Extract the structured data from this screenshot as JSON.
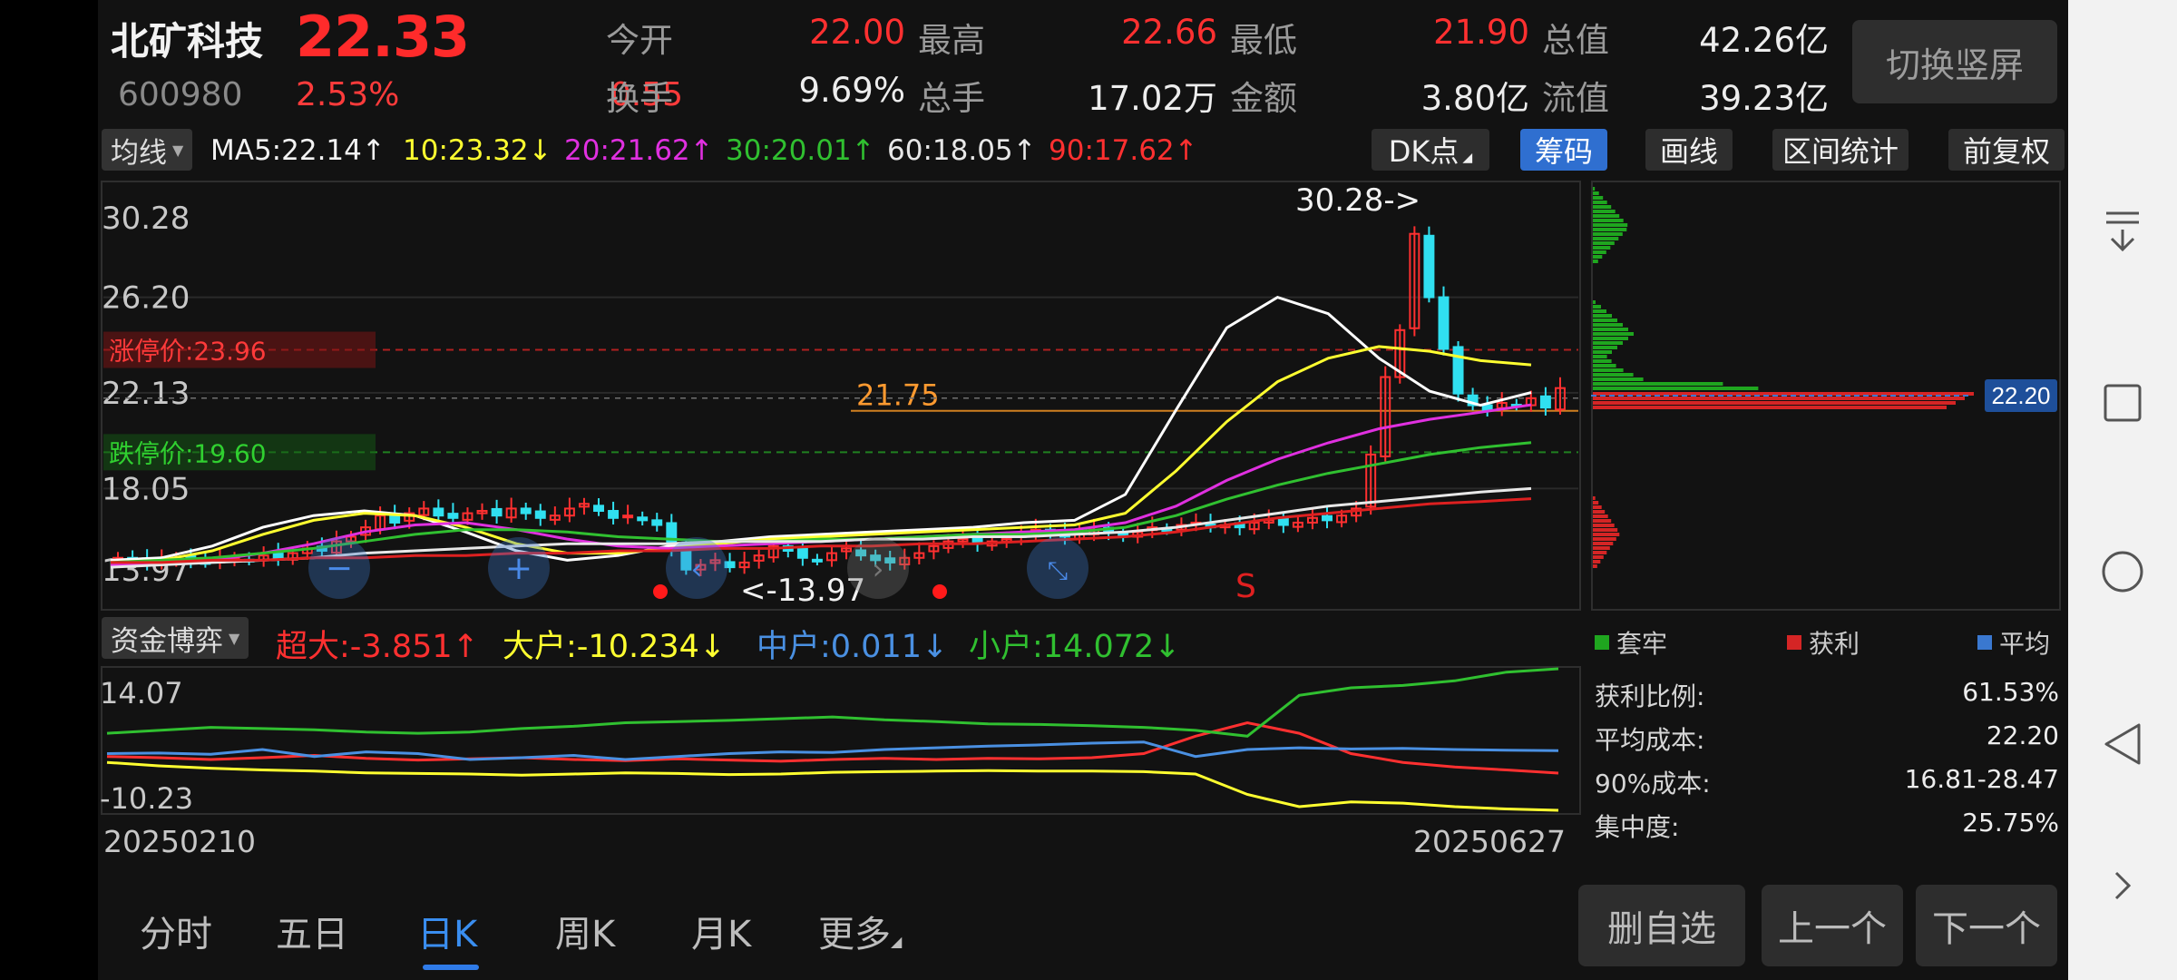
{
  "header": {
    "stock_name": "北矿科技",
    "price": "22.33",
    "code": "600980",
    "change_pct": "2.53%",
    "change_amt": "0.55",
    "stats": [
      {
        "label": "今开",
        "value": "22.00",
        "color": "red"
      },
      {
        "label": "最高",
        "value": "22.66",
        "color": "red"
      },
      {
        "label": "最低",
        "value": "21.90",
        "color": "red"
      },
      {
        "label": "总值",
        "value": "42.26亿",
        "color": "white"
      },
      {
        "label": "换手",
        "value": "9.69%",
        "color": "white"
      },
      {
        "label": "总手",
        "value": "17.02万",
        "color": "white"
      },
      {
        "label": "金额",
        "value": "3.80亿",
        "color": "white"
      },
      {
        "label": "流值",
        "value": "39.23亿",
        "color": "white"
      }
    ],
    "switch_button": "切换竖屏"
  },
  "ma_row": {
    "indicator_dropdown": "均线",
    "ma_items": [
      {
        "text": "MA5:22.14↑",
        "color": "#f2f2f2"
      },
      {
        "text": "10:23.32↓",
        "color": "#ffff30"
      },
      {
        "text": "20:21.62↑",
        "color": "#e030e0"
      },
      {
        "text": "30:20.01↑",
        "color": "#30c030"
      },
      {
        "text": "60:18.05↑",
        "color": "#e8e8e8"
      },
      {
        "text": "90:17.62↑",
        "color": "#ff3030"
      }
    ],
    "tools": [
      "DK点",
      "筹码",
      "画线",
      "区间统计",
      "前复权"
    ],
    "active_tool": "筹码"
  },
  "kline": {
    "y_ticks": [
      "30.28",
      "26.20",
      "22.13",
      "18.05",
      "13.97"
    ],
    "limit_up": "涨停价:23.96",
    "limit_down": "跌停价:19.60",
    "current_line_value": "21.75",
    "high_marker": "30.28->",
    "low_marker": "<-13.97",
    "sell_marker": "S",
    "price_tag": "22.20",
    "colors": {
      "up": "#ff3030",
      "down": "#30e0f0",
      "ma5": "#ffffff",
      "ma10": "#ffff30",
      "ma20": "#e030e0",
      "ma30": "#30c030",
      "ma60": "#e8e8e8",
      "ma90": "#dd2020"
    }
  },
  "chart_data": [
    {
      "type": "candlestick",
      "title": "",
      "ylim": [
        13.97,
        30.28
      ],
      "x_start": "20250210",
      "x_end": "20250627",
      "closes": [
        15.1,
        15.0,
        14.9,
        15.0,
        15.1,
        15.0,
        14.9,
        15.0,
        15.1,
        15.0,
        15.2,
        15.1,
        15.3,
        15.5,
        15.4,
        15.8,
        16.0,
        16.4,
        16.9,
        16.6,
        17.0,
        17.2,
        16.9,
        16.8,
        17.0,
        17.1,
        16.9,
        17.2,
        17.0,
        16.8,
        16.9,
        17.2,
        17.4,
        17.1,
        16.8,
        16.9,
        16.7,
        16.5,
        15.5,
        14.6,
        14.8,
        15.0,
        14.7,
        14.9,
        15.2,
        15.6,
        15.4,
        15.1,
        15.0,
        15.3,
        15.5,
        15.2,
        15.0,
        14.9,
        15.1,
        15.3,
        15.6,
        15.8,
        15.9,
        15.7,
        15.8,
        15.9,
        16.1,
        16.3,
        16.2,
        16.0,
        16.1,
        16.3,
        16.2,
        16.0,
        16.2,
        16.4,
        16.3,
        16.5,
        16.6,
        16.4,
        16.5,
        16.4,
        16.6,
        16.7,
        16.5,
        16.6,
        16.8,
        16.7,
        16.9,
        17.2,
        19.5,
        22.8,
        24.8,
        28.9,
        26.2,
        24.0,
        22.1,
        21.6,
        21.4,
        21.7,
        21.6,
        21.9,
        21.5,
        22.33
      ],
      "series": [
        {
          "name": "MA5",
          "values": [
            15.0,
            15.1,
            15.6,
            16.4,
            16.9,
            17.1,
            16.9,
            16.2,
            15.4,
            15.0,
            15.2,
            15.6,
            15.8,
            16.0,
            16.1,
            16.2,
            16.3,
            16.4,
            16.6,
            16.7,
            17.8,
            21.4,
            24.9,
            26.2,
            25.5,
            23.6,
            22.2,
            21.6,
            22.14
          ]
        },
        {
          "name": "MA10",
          "values": [
            14.9,
            15.0,
            15.4,
            16.1,
            16.7,
            17.0,
            16.9,
            16.4,
            15.7,
            15.3,
            15.3,
            15.5,
            15.7,
            15.9,
            16.0,
            16.1,
            16.2,
            16.3,
            16.4,
            16.5,
            17.0,
            18.8,
            20.9,
            22.6,
            23.6,
            24.1,
            23.9,
            23.5,
            23.32
          ]
        },
        {
          "name": "MA20",
          "values": [
            14.8,
            14.9,
            15.0,
            15.3,
            15.7,
            16.2,
            16.5,
            16.6,
            16.3,
            15.9,
            15.6,
            15.5,
            15.6,
            15.7,
            15.8,
            15.9,
            16.0,
            16.1,
            16.2,
            16.3,
            16.6,
            17.3,
            18.4,
            19.3,
            20.0,
            20.6,
            21.0,
            21.3,
            21.62
          ]
        },
        {
          "name": "MA30",
          "values": [
            14.9,
            15.0,
            15.1,
            15.3,
            15.5,
            15.8,
            16.1,
            16.3,
            16.3,
            16.2,
            16.0,
            15.9,
            15.8,
            15.8,
            15.9,
            15.9,
            16.0,
            16.1,
            16.1,
            16.2,
            16.4,
            16.9,
            17.6,
            18.2,
            18.7,
            19.1,
            19.5,
            19.8,
            20.01
          ]
        },
        {
          "name": "MA60",
          "values": [
            14.7,
            14.8,
            14.9,
            15.0,
            15.1,
            15.3,
            15.4,
            15.5,
            15.6,
            15.7,
            15.7,
            15.7,
            15.8,
            15.8,
            15.8,
            15.9,
            15.9,
            16.0,
            16.0,
            16.1,
            16.2,
            16.4,
            16.7,
            17.0,
            17.3,
            17.5,
            17.7,
            17.9,
            18.05
          ]
        },
        {
          "name": "MA90",
          "values": [
            14.9,
            14.9,
            15.0,
            15.0,
            15.1,
            15.1,
            15.2,
            15.2,
            15.3,
            15.3,
            15.4,
            15.4,
            15.5,
            15.5,
            15.6,
            15.6,
            15.7,
            15.7,
            15.8,
            15.9,
            16.0,
            16.2,
            16.5,
            16.8,
            17.0,
            17.2,
            17.4,
            17.5,
            17.62
          ]
        }
      ]
    },
    {
      "type": "line",
      "title": "资金博弈",
      "ylim": [
        -10.23,
        14.07
      ],
      "series": [
        {
          "name": "超大",
          "values": [
            -1.0,
            -1.2,
            -1.5,
            -1.2,
            -0.8,
            -1.3,
            -1.6,
            -1.4,
            -1.2,
            -1.5,
            -1.7,
            -1.4,
            -1.6,
            -1.8,
            -1.5,
            -1.3,
            -1.5,
            -1.3,
            -1.4,
            -1.2,
            -0.5,
            2.5,
            4.8,
            3.0,
            -0.5,
            -2.0,
            -2.8,
            -3.3,
            -3.851
          ]
        },
        {
          "name": "大户",
          "values": [
            -2.0,
            -2.6,
            -3.0,
            -3.3,
            -3.5,
            -3.8,
            -3.9,
            -4.0,
            -4.2,
            -4.0,
            -3.8,
            -3.9,
            -4.1,
            -4.0,
            -3.7,
            -3.6,
            -3.5,
            -3.4,
            -3.5,
            -3.5,
            -3.6,
            -4.0,
            -7.5,
            -9.6,
            -8.8,
            -9.0,
            -9.6,
            -10.0,
            -10.234
          ]
        },
        {
          "name": "中户",
          "values": [
            -0.5,
            -0.4,
            -0.6,
            0.2,
            -1.0,
            -0.2,
            -0.5,
            -1.5,
            -1.2,
            -0.8,
            -1.5,
            -1.0,
            -0.5,
            -0.2,
            -0.3,
            0.2,
            0.5,
            0.8,
            1.0,
            1.3,
            1.5,
            -1.0,
            0.2,
            0.5,
            0.3,
            0.4,
            0.2,
            0.1,
            0.011
          ]
        },
        {
          "name": "小户",
          "values": [
            3.0,
            3.5,
            4.0,
            3.8,
            3.6,
            3.2,
            3.0,
            3.2,
            3.8,
            4.2,
            4.8,
            5.0,
            5.2,
            5.5,
            5.8,
            5.3,
            5.0,
            4.6,
            4.5,
            4.3,
            4.0,
            3.5,
            2.5,
            9.5,
            10.8,
            11.2,
            12.0,
            13.5,
            14.072
          ]
        }
      ]
    }
  ],
  "fund": {
    "dropdown": "资金博弈",
    "items": [
      {
        "text": "超大:-3.851↑",
        "color": "#ff3030"
      },
      {
        "text": "大户:-10.234↓",
        "color": "#ffff30"
      },
      {
        "text": "中户:0.011↓",
        "color": "#4a90e2"
      },
      {
        "text": "小户:14.072↓",
        "color": "#30c030"
      }
    ],
    "y_top": "14.07",
    "y_bottom": "-10.23"
  },
  "dates": {
    "start": "20250210",
    "end": "20250627"
  },
  "chips": {
    "legend": [
      {
        "label": "套牢",
        "color": "#1fa61f"
      },
      {
        "label": "获利",
        "color": "#d52525"
      },
      {
        "label": "平均",
        "color": "#3a78d0"
      }
    ],
    "stats": [
      {
        "k": "获利比例:",
        "v": "61.53%"
      },
      {
        "k": "平均成本:",
        "v": "22.20"
      },
      {
        "k": "90%成本:",
        "v": "16.81-28.47"
      },
      {
        "k": "集中度:",
        "v": "25.75%"
      }
    ]
  },
  "tabs": [
    "分时",
    "五日",
    "日K",
    "周K",
    "月K",
    "更多"
  ],
  "active_tab": "日K",
  "bottom_buttons": [
    "删自选",
    "上一个",
    "下一个"
  ]
}
